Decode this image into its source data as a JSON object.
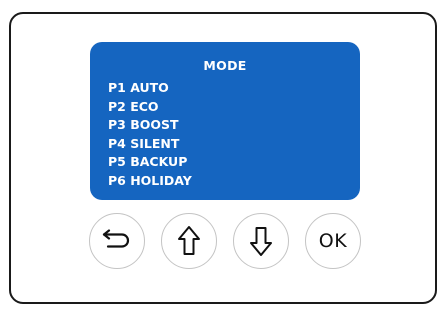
{
  "screen": {
    "title": "MODE",
    "items": [
      "P1 AUTO",
      "P2 ECO",
      "P3 BOOST",
      "P4 SILENT",
      "P5 BACKUP",
      "P6 HOLIDAY"
    ],
    "background_color": "#1565c0",
    "text_color": "#ffffff"
  },
  "buttons": {
    "back_icon": "return-arrow-icon",
    "up_icon": "arrow-up-outline-icon",
    "down_icon": "arrow-down-outline-icon",
    "ok_label": "OK"
  }
}
